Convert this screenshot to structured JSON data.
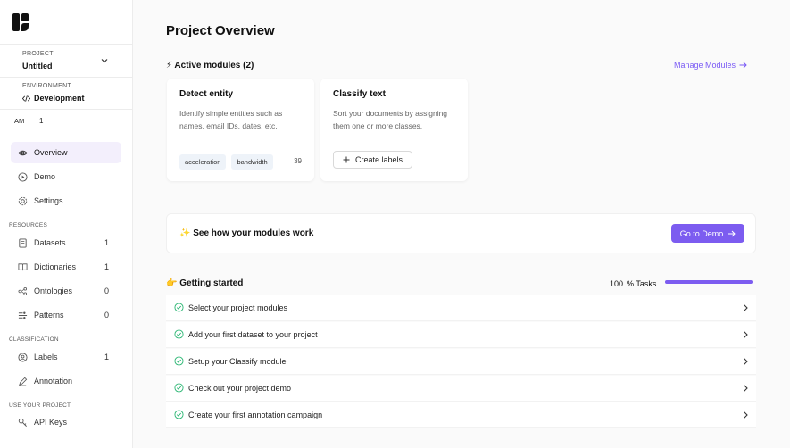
{
  "sidebar": {
    "project": {
      "label": "PROJECT",
      "value": "Untitled"
    },
    "environment": {
      "label": "ENVIRONMENT",
      "value": "Development"
    },
    "user": {
      "initials": "AM",
      "count": "1"
    },
    "nav": [
      {
        "label": "Overview",
        "icon": "eye-icon"
      },
      {
        "label": "Demo",
        "icon": "play-icon"
      },
      {
        "label": "Settings",
        "icon": "gear-icon"
      }
    ],
    "resources": {
      "label": "RESOURCES",
      "items": [
        {
          "label": "Datasets",
          "count": "1",
          "icon": "database-icon"
        },
        {
          "label": "Dictionaries",
          "count": "1",
          "icon": "book-icon"
        },
        {
          "label": "Ontologies",
          "count": "0",
          "icon": "ontology-icon"
        },
        {
          "label": "Patterns",
          "count": "0",
          "icon": "pattern-icon"
        }
      ]
    },
    "classification": {
      "label": "CLASSIFICATION",
      "items": [
        {
          "label": "Labels",
          "count": "1",
          "icon": "label-icon"
        },
        {
          "label": "Annotation",
          "count": "",
          "icon": "pen-icon"
        }
      ]
    },
    "use_project": {
      "label": "USE YOUR PROJECT",
      "items": [
        {
          "label": "API Keys",
          "icon": "key-icon"
        }
      ]
    }
  },
  "main": {
    "title": "Project Overview",
    "active_modules": {
      "heading": "⚡ Active modules (2)",
      "manage_label": "Manage Modules",
      "cards": [
        {
          "title": "Detect entity",
          "description": "Identify simple entities such as names, email IDs, dates, etc.",
          "tags": [
            "acceleration",
            "bandwidth"
          ],
          "tag_count": "39"
        },
        {
          "title": "Classify text",
          "description": "Sort your documents by assigning them one or more classes.",
          "button_label": "Create labels"
        }
      ]
    },
    "demo_banner": {
      "text": "✨ See how your modules work",
      "button_label": "Go to Demo"
    },
    "getting_started": {
      "heading": "👉 Getting started",
      "progress_value": "100",
      "progress_label": "% Tasks",
      "progress_fraction": 1.0,
      "tasks": [
        "Select your project modules",
        "Add your first dataset to your project",
        "Setup your Classify module",
        "Check out your project demo",
        "Create your first annotation campaign"
      ]
    }
  },
  "colors": {
    "accent": "#7c5cf0",
    "check": "#2bb673",
    "active_nav_bg": "#f3effc"
  }
}
